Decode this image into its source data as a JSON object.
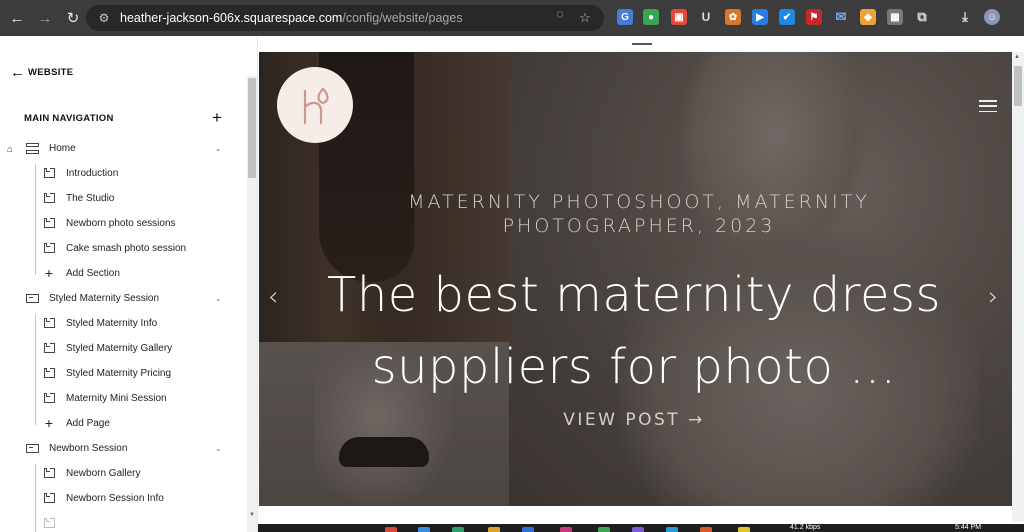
{
  "browser": {
    "url_host": "heather-jackson-606x.squarespace.com",
    "url_path": "/config/website/pages",
    "icons": [
      "back-icon",
      "forward-icon",
      "reload-icon",
      "site-settings-icon",
      "eye-off-icon",
      "star-icon",
      "downloads-icon",
      "profile-avatar"
    ],
    "extension_badge": "U"
  },
  "sidebar": {
    "back_label": "WEBSITE",
    "section_title": "MAIN NAVIGATION",
    "items": [
      {
        "label": "Home",
        "type": "index",
        "level": 0,
        "is_home": true,
        "expanded": true
      },
      {
        "label": "Introduction",
        "type": "page",
        "level": 1
      },
      {
        "label": "The Studio",
        "type": "page",
        "level": 1
      },
      {
        "label": "Newborn photo sessions",
        "type": "page",
        "level": 1
      },
      {
        "label": "Cake smash photo session",
        "type": "page",
        "level": 1
      },
      {
        "label": "Add Section",
        "type": "add",
        "level": 1
      },
      {
        "label": "Styled Maternity Session",
        "type": "folder",
        "level": 0,
        "expanded": true
      },
      {
        "label": "Styled Maternity Info",
        "type": "page",
        "level": 1
      },
      {
        "label": "Styled Maternity Gallery",
        "type": "page",
        "level": 1
      },
      {
        "label": "Styled Maternity Pricing",
        "type": "page",
        "level": 1
      },
      {
        "label": "Maternity Mini Session",
        "type": "page",
        "level": 1
      },
      {
        "label": "Add Page",
        "type": "add",
        "level": 1
      },
      {
        "label": "Newborn Session",
        "type": "folder",
        "level": 0,
        "expanded": true
      },
      {
        "label": "Newborn Gallery",
        "type": "page",
        "level": 1
      },
      {
        "label": "Newborn Session Info",
        "type": "page",
        "level": 1
      }
    ]
  },
  "preview": {
    "kicker": "MATERNITY PHOTOSHOOT, MATERNITY PHOTOGRAPHER, 2023",
    "headline": "The best maternity dress suppliers for photo ...",
    "cta": "VIEW POST →",
    "prev_arrow": "‹",
    "next_arrow": "›",
    "logo_color": "#c99a8c"
  },
  "taskbar": {
    "status_text": "41.2 kbps",
    "time_text": "5:44 PM"
  }
}
